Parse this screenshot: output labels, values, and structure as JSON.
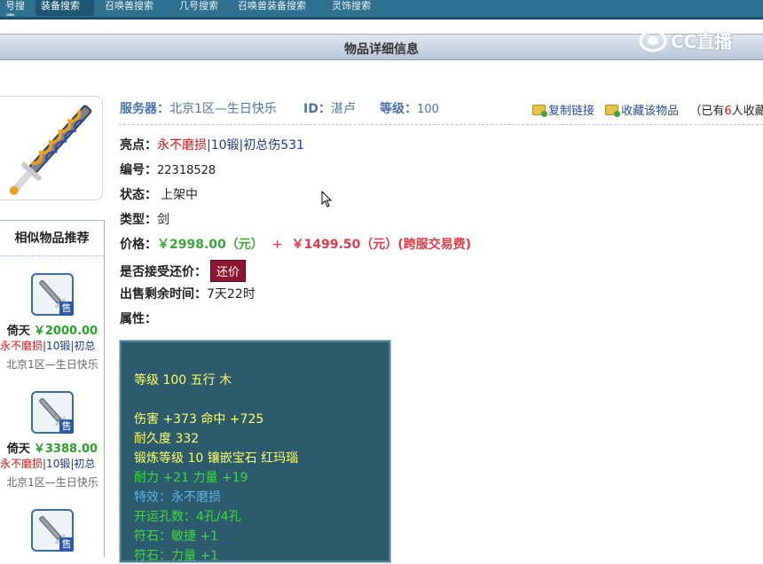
{
  "nav": {
    "tabs": [
      {
        "label": "号搜索",
        "active": false
      },
      {
        "label": "装备搜索",
        "active": true
      },
      {
        "label": "召唤兽搜索",
        "active": false
      },
      {
        "label": "几号搜索",
        "active": false
      },
      {
        "label": "召唤兽装备搜索",
        "active": false
      },
      {
        "label": "灵饰搜索",
        "active": false
      }
    ]
  },
  "page": {
    "title": "物品详细信息",
    "logo_text": "CC直播"
  },
  "header": {
    "server_label": "服务器：",
    "server_value": "北京1区—生日快乐",
    "id_label": "ID：",
    "id_value": "湛卢",
    "level_label": "等级：",
    "level_value": "100",
    "copy_link": "复制链接",
    "favorite": "收藏该物品",
    "fav_count_pre": "（已有",
    "fav_count": "6",
    "fav_count_post": "人收藏）"
  },
  "details": {
    "highlight_label": "亮点：",
    "highlight_red": "永不磨损",
    "highlight_blue": "|10锻|初总伤531",
    "serial_label": "编号：",
    "serial_value": "22318528",
    "status_label": "状态：",
    "status_value": "上架中",
    "type_label": "类型：",
    "type_value": "剑",
    "price_label": "价格：",
    "price_value": "￥2998.00（元）",
    "price_plus": "+",
    "fee_value": "￥1499.50（元）(跨服交易费)",
    "bargain_label": "是否接受还价：",
    "bargain_button": "还价",
    "time_label": "出售剩余时间：",
    "time_value": "7天22时",
    "attr_label": "属性："
  },
  "attributes": [
    {
      "text": "等级 100 五行 木",
      "color": "yellow"
    },
    {
      "text": "伤害 +373 命中 +725",
      "color": "yellow"
    },
    {
      "text": "耐久度 332",
      "color": "yellow"
    },
    {
      "text": "锻炼等级 10 镶嵌宝石 红玛瑙",
      "color": "yellow"
    },
    {
      "text": "耐力 +21 力量 +19",
      "color": "green"
    },
    {
      "text": "特效：永不磨损",
      "color": "cyan"
    },
    {
      "text": "开运孔数：4孔/4孔",
      "color": "green"
    },
    {
      "text": "符石：敏捷 +1",
      "color": "green"
    },
    {
      "text": "符石：力量 +1",
      "color": "green"
    }
  ],
  "sidebar": {
    "heading": "相似物品推荐",
    "items": [
      {
        "name": "倚天",
        "price": "￥2000.00",
        "tag_red": "永不磨损",
        "tag_blue": "|10锻|初总",
        "server": "北京1区—生日快乐",
        "badge": "售"
      },
      {
        "name": "倚天",
        "price": "￥3388.00",
        "tag_red": "永不磨损",
        "tag_blue": "|10锻|初总",
        "server": "北京1区—生日快乐",
        "badge": "售"
      },
      {
        "name": "",
        "price": "",
        "tag_red": "",
        "tag_blue": "",
        "server": "",
        "badge": "售"
      }
    ]
  },
  "colors": {
    "nav_bg": "#2f6f8f",
    "price": "#e23a4a",
    "attr_bg": "#2c5b6e",
    "bargain_btn": "#8e1630"
  }
}
